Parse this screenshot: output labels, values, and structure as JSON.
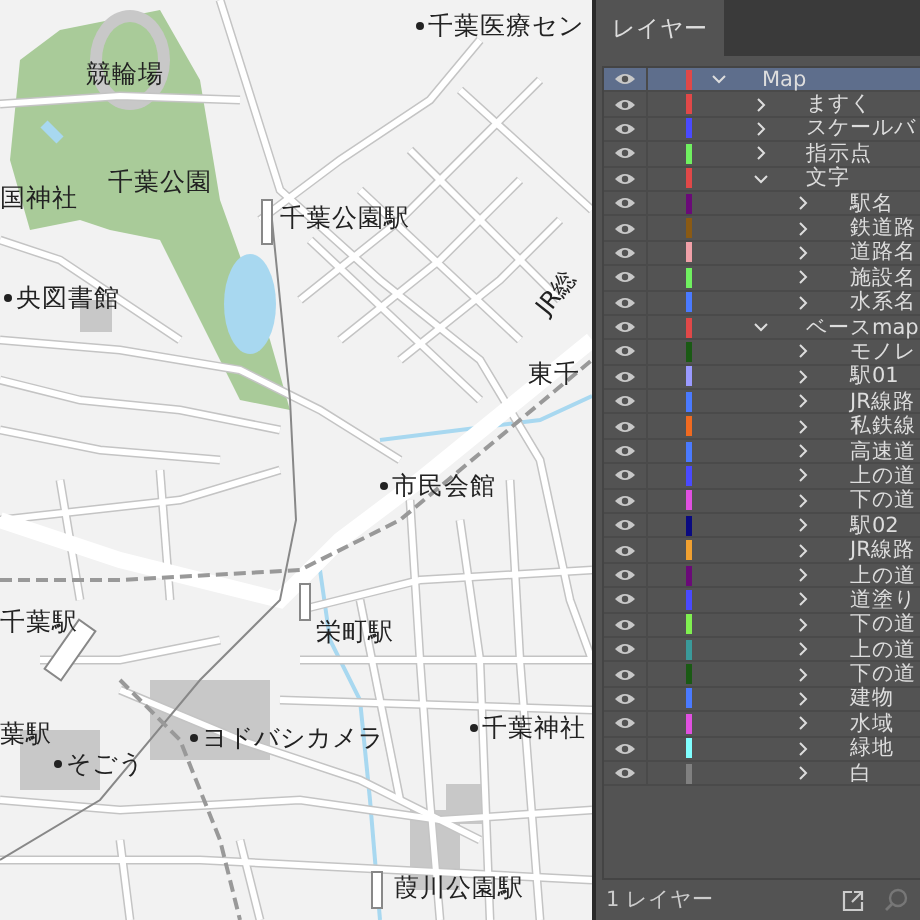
{
  "map": {
    "labels": [
      {
        "text": "千葉医療セン",
        "kind": "poi"
      },
      {
        "text": "競輪場",
        "kind": "place"
      },
      {
        "text": "千葉公園",
        "kind": "place"
      },
      {
        "text": "国神社",
        "kind": "place"
      },
      {
        "text": "千葉公園駅",
        "kind": "station"
      },
      {
        "text": "央図書館",
        "kind": "poi"
      },
      {
        "text": "JR総",
        "kind": "railway"
      },
      {
        "text": "東千",
        "kind": "station"
      },
      {
        "text": "市民会館",
        "kind": "poi"
      },
      {
        "text": "千葉駅",
        "kind": "station"
      },
      {
        "text": "栄町駅",
        "kind": "station"
      },
      {
        "text": "葉駅",
        "kind": "station"
      },
      {
        "text": "ヨドバシカメラ",
        "kind": "poi"
      },
      {
        "text": "千葉神社",
        "kind": "poi"
      },
      {
        "text": "そごう",
        "kind": "poi"
      },
      {
        "text": "葭川公園駅",
        "kind": "station"
      }
    ]
  },
  "panel": {
    "tab": "レイヤー",
    "layers": [
      {
        "name": "Map",
        "color": "#e04848",
        "selected": true,
        "expanded": true,
        "children": [
          {
            "name": "ますく",
            "color": "#e04848",
            "selected": false,
            "expanded": false
          },
          {
            "name": "スケールバ",
            "color": "#4a4aff",
            "selected": false,
            "expanded": false
          },
          {
            "name": "指示点",
            "color": "#70f060",
            "selected": false,
            "expanded": false
          },
          {
            "name": "文字",
            "color": "#e04848",
            "selected": false,
            "expanded": true,
            "children": [
              {
                "name": "駅名",
                "color": "#6a0a78",
                "selected": false,
                "expanded": false
              },
              {
                "name": "鉄道路",
                "color": "#8a5a14",
                "selected": false,
                "expanded": false
              },
              {
                "name": "道路名",
                "color": "#f0a0a8",
                "selected": false,
                "expanded": false
              },
              {
                "name": "施設名",
                "color": "#70f060",
                "selected": false,
                "expanded": false
              },
              {
                "name": "水系名",
                "color": "#4a7aff",
                "selected": false,
                "expanded": false
              }
            ]
          },
          {
            "name": "ベースmap",
            "color": "#e04848",
            "selected": false,
            "expanded": true,
            "children": [
              {
                "name": "モノレ",
                "color": "#1a5a14",
                "selected": false,
                "expanded": false
              },
              {
                "name": "駅01",
                "color": "#9a9aff",
                "selected": false,
                "expanded": false
              },
              {
                "name": "JR線路",
                "color": "#4a7aff",
                "selected": false,
                "expanded": false
              },
              {
                "name": "私鉄線",
                "color": "#f06a20",
                "selected": false,
                "expanded": false
              },
              {
                "name": "高速道",
                "color": "#4a7aff",
                "selected": false,
                "expanded": false
              },
              {
                "name": "上の道",
                "color": "#4a4aff",
                "selected": false,
                "expanded": false
              },
              {
                "name": "下の道",
                "color": "#e050e0",
                "selected": false,
                "expanded": false
              },
              {
                "name": "駅02",
                "color": "#0a0a80",
                "selected": false,
                "expanded": false
              },
              {
                "name": "JR線路",
                "color": "#f0a030",
                "selected": false,
                "expanded": false
              },
              {
                "name": "上の道",
                "color": "#6a0a78",
                "selected": false,
                "expanded": false
              },
              {
                "name": "道塗り",
                "color": "#4a4aff",
                "selected": false,
                "expanded": false
              },
              {
                "name": "下の道",
                "color": "#80f050",
                "selected": false,
                "expanded": false
              },
              {
                "name": "上の道",
                "color": "#3a9a9a",
                "selected": false,
                "expanded": false
              },
              {
                "name": "下の道",
                "color": "#1a5a14",
                "selected": false,
                "expanded": false
              },
              {
                "name": "建物",
                "color": "#4a7aff",
                "selected": false,
                "expanded": false
              },
              {
                "name": "水域",
                "color": "#e050e0",
                "selected": false,
                "expanded": false
              },
              {
                "name": "緑地",
                "color": "#80ffff",
                "selected": false,
                "expanded": false
              },
              {
                "name": "白",
                "color": "#808080",
                "selected": false,
                "expanded": false
              }
            ]
          }
        ]
      }
    ],
    "footer": "1 レイヤー"
  }
}
